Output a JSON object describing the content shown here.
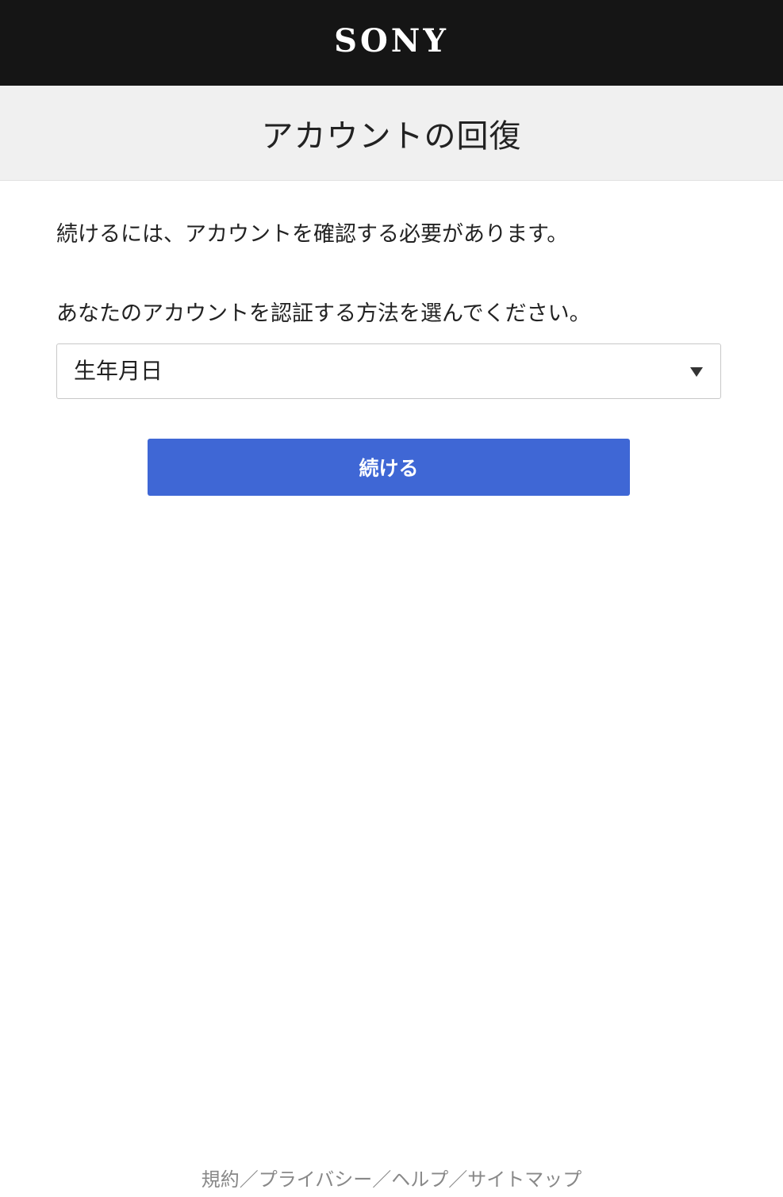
{
  "header": {
    "logo_text": "SONY",
    "logo_color": "#ffffff",
    "background_color": "#151515"
  },
  "title_band": {
    "title": "アカウントの回復"
  },
  "main": {
    "intro_text": "続けるには、アカウントを確認する必要があります。",
    "method_label": "あなたのアカウントを認証する方法を選んでください。",
    "method_select": {
      "selected_value": "生年月日",
      "icon": "chevron-down-icon"
    },
    "continue_button": {
      "label": "続ける",
      "color": "#3f67d5"
    }
  },
  "footer": {
    "links": [
      {
        "label": "規約"
      },
      {
        "label": "プライバシー"
      },
      {
        "label": "ヘルプ"
      },
      {
        "label": "サイトマップ"
      }
    ],
    "separator": "／"
  }
}
